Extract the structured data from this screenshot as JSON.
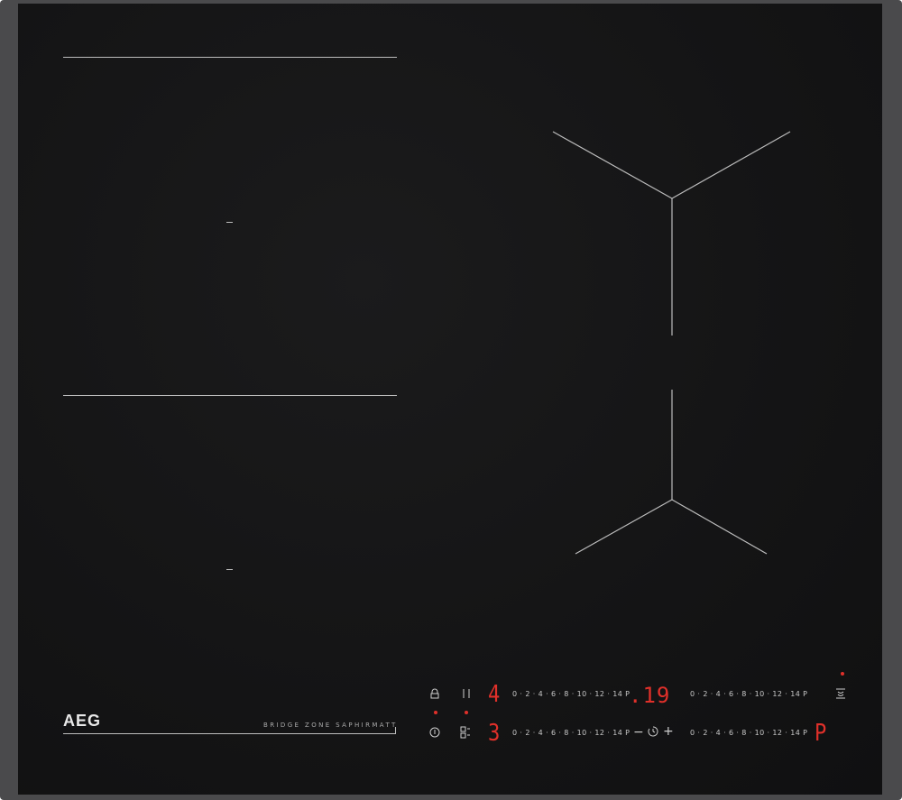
{
  "brand": {
    "logo": "AEG",
    "model_tag": "BRIDGE ZONE SAPHIRMATT"
  },
  "controls": {
    "scale_text": "0 · 2 · 4 · 6 · 8 · 10 · 12 · 14 P",
    "zone_1_level": "4",
    "zone_2_level": "3",
    "zone_4_level": "P",
    "timer_display": ".19",
    "timer_minus": "−",
    "timer_plus": "+"
  },
  "icons": {
    "lock": "lock-icon",
    "power": "power-icon",
    "bridge": "bridge-icon",
    "pause": "pause-icon",
    "timer": "timer-icon",
    "hob2hood": "hob2hood-icon"
  },
  "colors": {
    "display_red": "#e0302a",
    "glass": "#141415",
    "frame": "#4a4a4c",
    "marking": "#bdbdbd"
  }
}
